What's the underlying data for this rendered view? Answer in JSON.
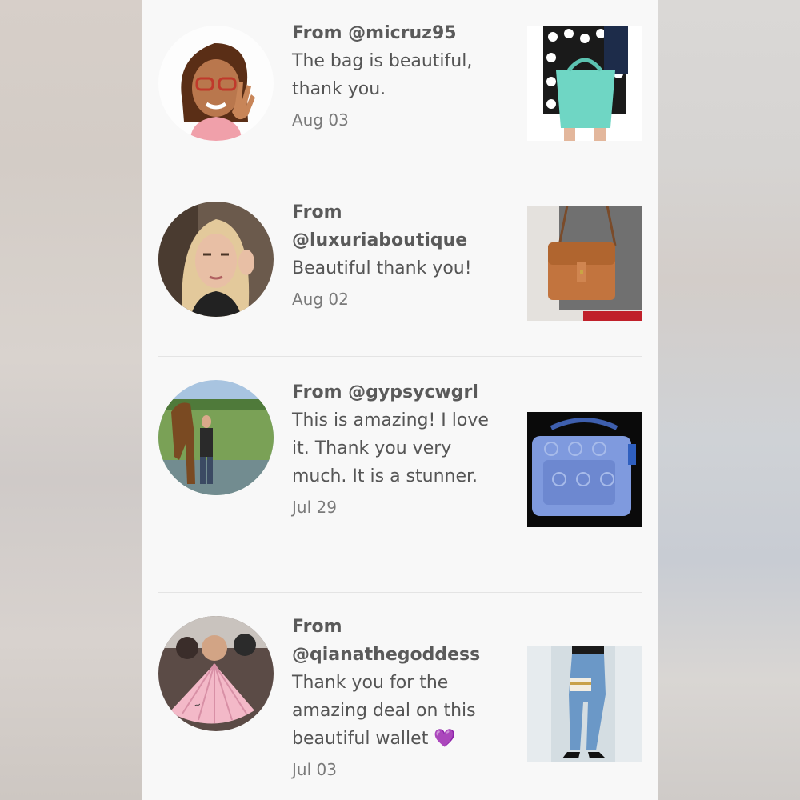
{
  "reviews": [
    {
      "from": "From @micruz95",
      "message": "The bag is beautiful, thank you.",
      "date": "Aug 03",
      "avatar_icon": "bitmoji-avatar",
      "thumb_icon": "mint-tote-bag-photo"
    },
    {
      "from": "From @luxuriaboutique",
      "message": "Beautiful thank you!",
      "date": "Aug 02",
      "avatar_icon": "selfie-avatar",
      "thumb_icon": "tan-crossbody-bag-photo"
    },
    {
      "from": "From @gypsycwgrl",
      "message": "This is amazing! I love it. Thank you very much. It is a stunner.",
      "date": "Jul 29",
      "avatar_icon": "horse-field-avatar",
      "thumb_icon": "blue-signature-bag-photo"
    },
    {
      "from": "From @qianathegoddess",
      "message": "Thank you for the amazing deal on this beautiful wallet",
      "emoji": "💜",
      "date": "Jul 03",
      "avatar_icon": "fan-group-avatar",
      "thumb_icon": "jeans-wallet-photo"
    }
  ],
  "colors": {
    "panel_bg": "#f8f8f8",
    "text": "#555555",
    "date": "#7a7a7a",
    "divider": "#e4e4e4"
  }
}
